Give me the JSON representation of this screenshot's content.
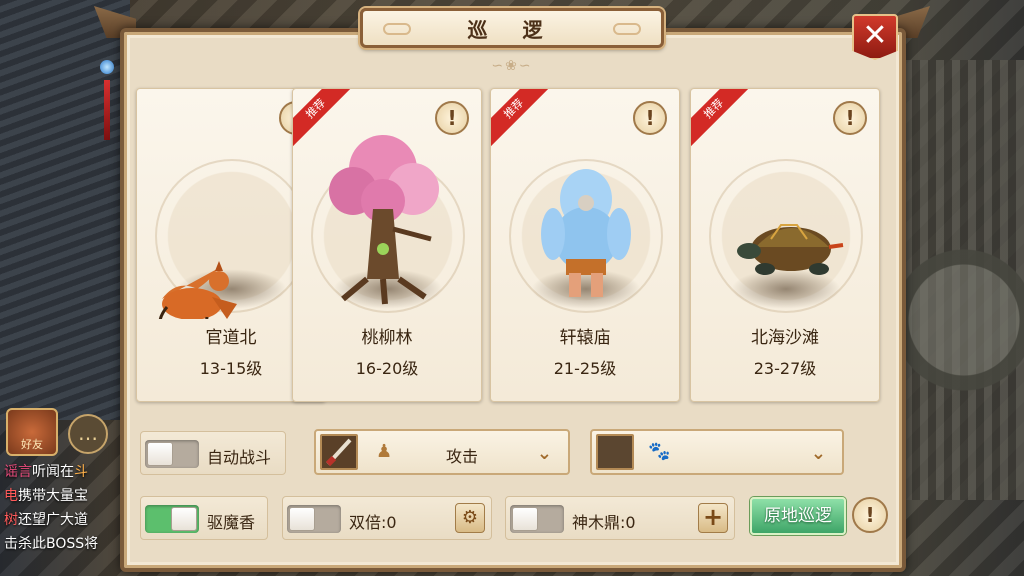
{
  "window": {
    "title": "巡 逻"
  },
  "close_button": {
    "label": "✕"
  },
  "zones": [
    {
      "name": "官道北",
      "level": "13-15级",
      "recommended": false,
      "monster_icon": "fox-icon"
    },
    {
      "name": "桃柳林",
      "level": "16-20级",
      "recommended": true,
      "monster_icon": "tree-monster-icon"
    },
    {
      "name": "轩辕庙",
      "level": "21-25级",
      "recommended": true,
      "monster_icon": "yeti-monster-icon"
    },
    {
      "name": "北海沙滩",
      "level": "23-27级",
      "recommended": true,
      "monster_icon": "turtle-monster-icon"
    }
  ],
  "ribbon_label": "推荐",
  "info_label": "!",
  "controls": {
    "auto_battle": {
      "label": "自动战斗",
      "on": false
    },
    "skill_dropdown": {
      "value": "攻击"
    },
    "pet_dropdown": {
      "value": ""
    },
    "repel_incense": {
      "label": "驱魔香",
      "on": true
    },
    "double": {
      "label": "双倍:0",
      "on": false
    },
    "shenmu": {
      "label": "神木鼎:0",
      "on": false
    },
    "patrol_button": {
      "label": "原地巡逻"
    },
    "help_label": "!"
  },
  "left_hud": {
    "friend_label": "好友",
    "chat_lines": [
      {
        "tag": "谣言",
        "text": "听闻在",
        "hi": "斗"
      },
      {
        "tag": "电",
        "text": "携带大量宝"
      },
      {
        "tag": "树",
        "text": "还望广大道"
      },
      {
        "tag": "",
        "text": "击杀此BOSS将"
      }
    ]
  },
  "colors": {
    "ribbon": "#d32a25",
    "toggle_on": "#5cbf6d",
    "panel_bg": "#e9dcc5",
    "primary_button": "#3ea567"
  }
}
